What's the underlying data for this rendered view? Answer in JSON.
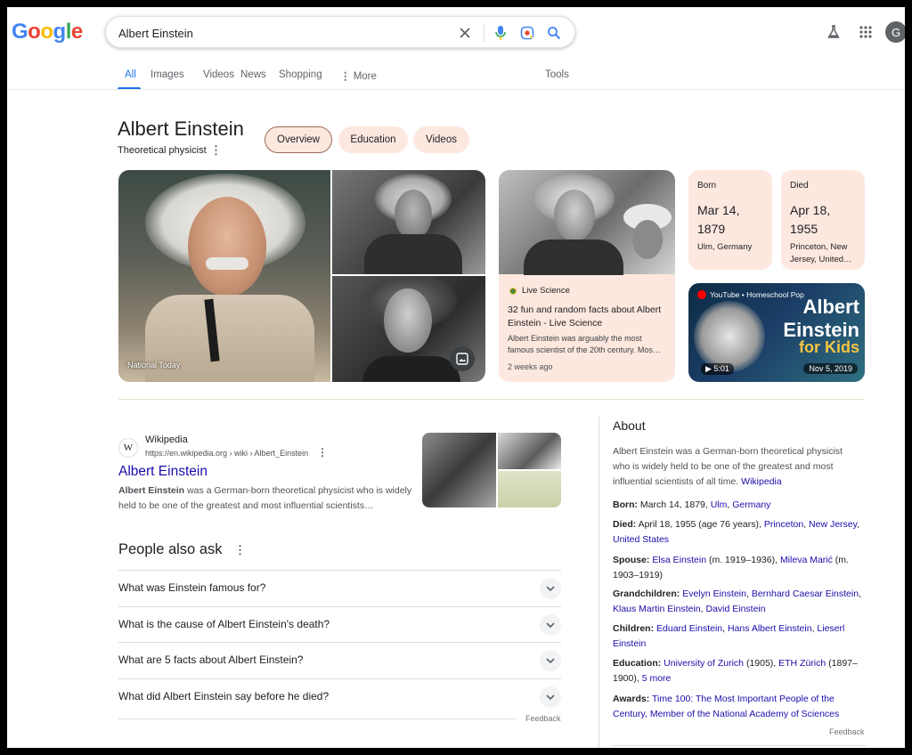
{
  "header": {
    "logo": "Google",
    "query": "Albert Einstein",
    "avatar_initial": "G"
  },
  "tabs": [
    {
      "label": "All",
      "active": true
    },
    {
      "label": "Images"
    },
    {
      "label": "Videos"
    },
    {
      "label": "News"
    },
    {
      "label": "Shopping"
    },
    {
      "label": "More"
    },
    {
      "label": "Tools"
    }
  ],
  "entity": {
    "title": "Albert Einstein",
    "subtitle": "Theoretical physicist",
    "chips": [
      "Overview",
      "Education",
      "Videos"
    ],
    "active_chip": "Overview"
  },
  "images": {
    "main_caption": "National Today"
  },
  "live_science": {
    "source": "Live Science",
    "title": "32 fun and random facts about Albert Einstein - Live Science",
    "desc": "Albert Einstein was arguably the most famous scientist of the 20th century. Mos…",
    "time": "2 weeks ago"
  },
  "born": {
    "label": "Born",
    "date": "Mar 14, 1879",
    "place": "Ulm, Germany"
  },
  "died": {
    "label": "Died",
    "date": "Apr 18, 1955",
    "place": "Princeton, New Jersey, United…"
  },
  "video": {
    "source": "YouTube • Homeschool Pop",
    "title_line1": "Albert",
    "title_line2": "Einstein",
    "title_line3": "for Kids",
    "duration": "5:01",
    "date": "Nov 5, 2019"
  },
  "wiki_result": {
    "site": "Wikipedia",
    "url": "https://en.wikipedia.org › wiki › Albert_Einstein",
    "title": "Albert Einstein",
    "snippet_bold": "Albert Einstein",
    "snippet_rest": " was a German-born theoretical physicist who is widely held to be one of the greatest and most influential scientists…"
  },
  "paa": {
    "title": "People also ask",
    "questions": [
      "What was Einstein famous for?",
      "What is the cause of Albert Einstein's death?",
      "What are 5 facts about Albert Einstein?",
      "What did Albert Einstein say before he died?"
    ],
    "feedback": "Feedback"
  },
  "about": {
    "heading": "About",
    "desc": "Albert Einstein was a German-born theoretical physicist who is widely held to be one of the greatest and most influential scientists of all time. ",
    "desc_link": "Wikipedia",
    "born_label": "Born:",
    "born_text": " March 14, 1879, ",
    "born_links": [
      "Ulm",
      "Germany"
    ],
    "died_label": "Died:",
    "died_text": " April 18, 1955 (age 76 years), ",
    "died_links": [
      "Princeton",
      "New Jersey",
      "United States"
    ],
    "spouse_label": "Spouse:",
    "spouse_link1": "Elsa Einstein",
    "spouse_text1": " (m. 1919–1936), ",
    "spouse_link2": "Mileva Marić",
    "spouse_text2": " (m. 1903–1919)",
    "grand_label": "Grandchildren:",
    "grand_links": [
      "Evelyn Einstein",
      "Bernhard Caesar Einstein",
      "Klaus Martin Einstein",
      "David Einstein"
    ],
    "children_label": "Children:",
    "children_links": [
      "Eduard Einstein",
      "Hans Albert Einstein",
      "Lieserl Einstein"
    ],
    "education_label": "Education:",
    "edu_link1": "University of Zurich",
    "edu_text1": " (1905), ",
    "edu_link2": "ETH Zürich",
    "edu_text2": " (1897–1900), ",
    "edu_more": "5 more",
    "awards_label": "Awards:",
    "awards_text": "Time 100: The Most Important People of the Century, Member of the National Academy of Sciences",
    "feedback": "Feedback"
  },
  "colors": {
    "accent": "#1a73e8",
    "link": "#1a0dab",
    "chip_bg": "#fde8df"
  }
}
